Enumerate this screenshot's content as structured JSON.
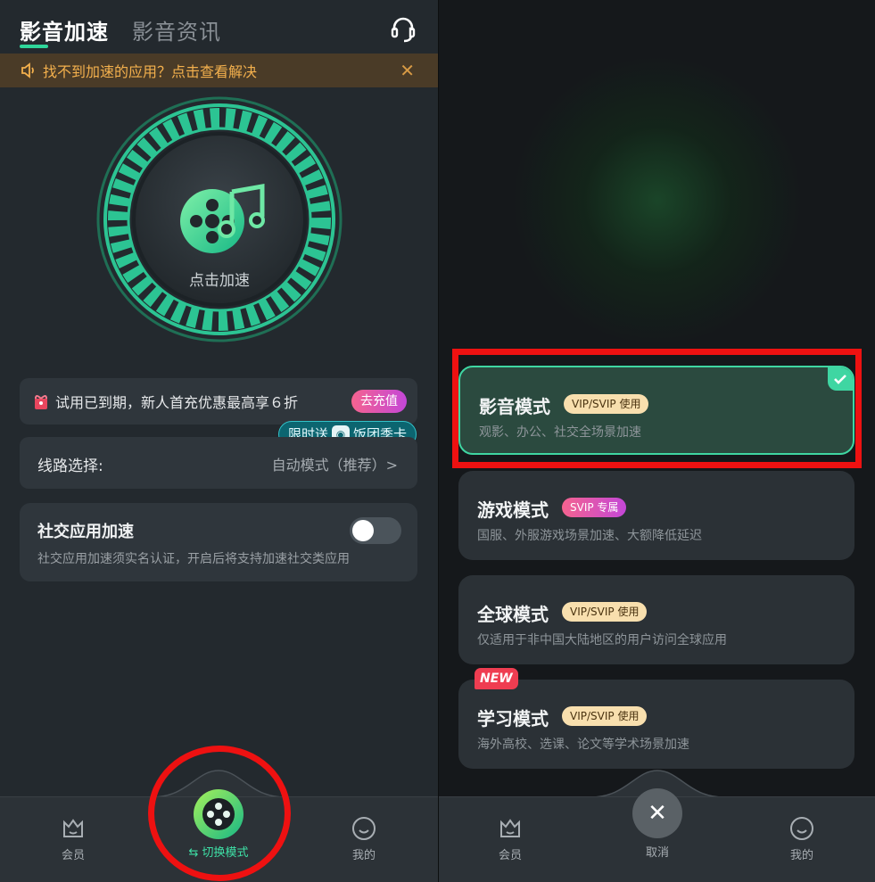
{
  "left": {
    "tabs": [
      "影音加速",
      "影音资讯"
    ],
    "notice": "找不到加速的应用？点击查看解决",
    "center_label": "点击加速",
    "promo": {
      "text": "试用已到期，新人首充优惠最高享６折",
      "button": "去充值",
      "tag_prefix": "限时送",
      "tag_suffix": "饭团季卡"
    },
    "route": {
      "label": "线路选择:",
      "value": "自动模式（推荐）>"
    },
    "social": {
      "title": "社交应用加速",
      "desc": "社交应用加速须实名认证，开启后将支持加速社交类应用",
      "toggle_on": false
    },
    "nav": {
      "member": "会员",
      "switch": "⇆ 切换模式",
      "mine": "我的"
    }
  },
  "right": {
    "modes": [
      {
        "title": "影音模式",
        "badge": "VIP/SVIP 使用",
        "badge_type": "vip",
        "desc": "观影、办公、社交全场景加速",
        "selected": true
      },
      {
        "title": "游戏模式",
        "badge": "SVIP 专属",
        "badge_type": "svip",
        "desc": "国服、外服游戏场景加速、大额降低延迟",
        "selected": false
      },
      {
        "title": "全球模式",
        "badge": "VIP/SVIP 使用",
        "badge_type": "vip",
        "desc": "仅适用于非中国大陆地区的用户访问全球应用",
        "selected": false
      },
      {
        "title": "学习模式",
        "badge": "VIP/SVIP 使用",
        "badge_type": "vip",
        "desc": "海外高校、选课、论文等学术场景加速",
        "selected": false
      }
    ],
    "new_tag": "NEW",
    "nav": {
      "member": "会员",
      "cancel": "取消",
      "mine": "我的"
    }
  },
  "colors": {
    "accent": "#3fd6a2",
    "notice_text": "#f3b04d",
    "annotation": "#ee1111"
  }
}
